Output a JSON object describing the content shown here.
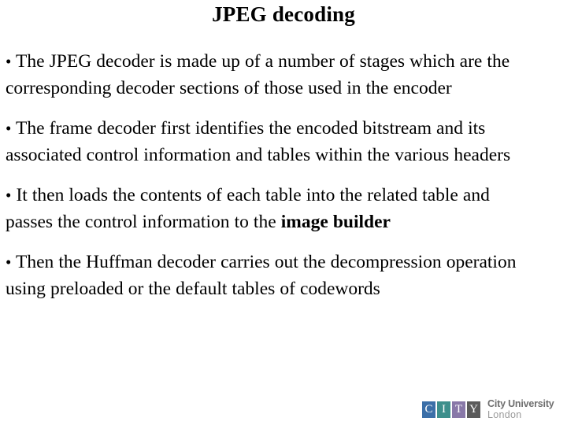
{
  "slide": {
    "title": "JPEG decoding",
    "background_color": "#ffffff",
    "text_color": "#000000"
  },
  "bullets": [
    {
      "marker": "•",
      "text": "The JPEG decoder is made up of a number of stages which are the corresponding decoder sections of those used in the encoder"
    },
    {
      "marker": "•",
      "text": "The frame decoder first identifies the encoded bitstream and its associated control information and tables within the various headers"
    },
    {
      "marker": "•",
      "text_before_bold": "It then loads the contents of each table into the related table and passes the control information to the ",
      "bold_text": "image builder",
      "text_after_bold": ""
    },
    {
      "marker": "•",
      "text": "Then the Huffman decoder carries out the decompression operation using preloaded or the default tables of codewords"
    }
  ],
  "logo": {
    "squares": [
      {
        "letter": "C",
        "color": "#3b6fa8"
      },
      {
        "letter": "I",
        "color": "#3d8f8c"
      },
      {
        "letter": "T",
        "color": "#8878a8"
      },
      {
        "letter": "Y",
        "color": "#5a5a5a"
      }
    ],
    "line_1": "City University",
    "line_2": "London",
    "line_1_color": "#6e6e6e",
    "line_2_color": "#9a9a9a"
  }
}
